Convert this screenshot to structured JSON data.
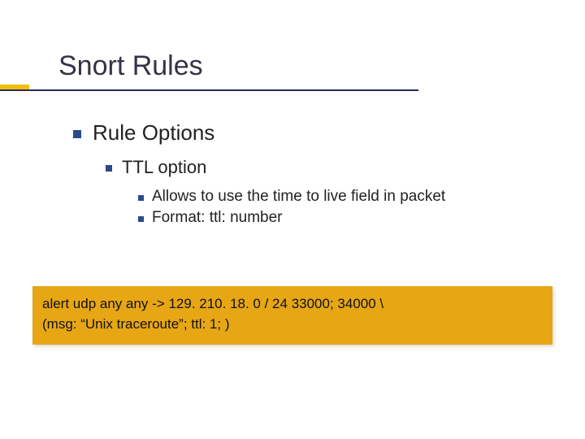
{
  "title": "Snort Rules",
  "bullets": {
    "lvl1": "Rule Options",
    "lvl2": "TTL option",
    "lvl3": [
      "Allows to use the time to live field in packet",
      "Format: ttl: number"
    ]
  },
  "code": {
    "line1": "alert udp any any -> 129. 210. 18. 0 / 24 33000; 34000 \\",
    "line2": "(msg: “Unix traceroute”; ttl: 1; )"
  },
  "colors": {
    "accent": "#f0c000",
    "underline": "#2a2a60",
    "bullet": "#2a4a8a",
    "codebox_bg": "#e7a614"
  }
}
